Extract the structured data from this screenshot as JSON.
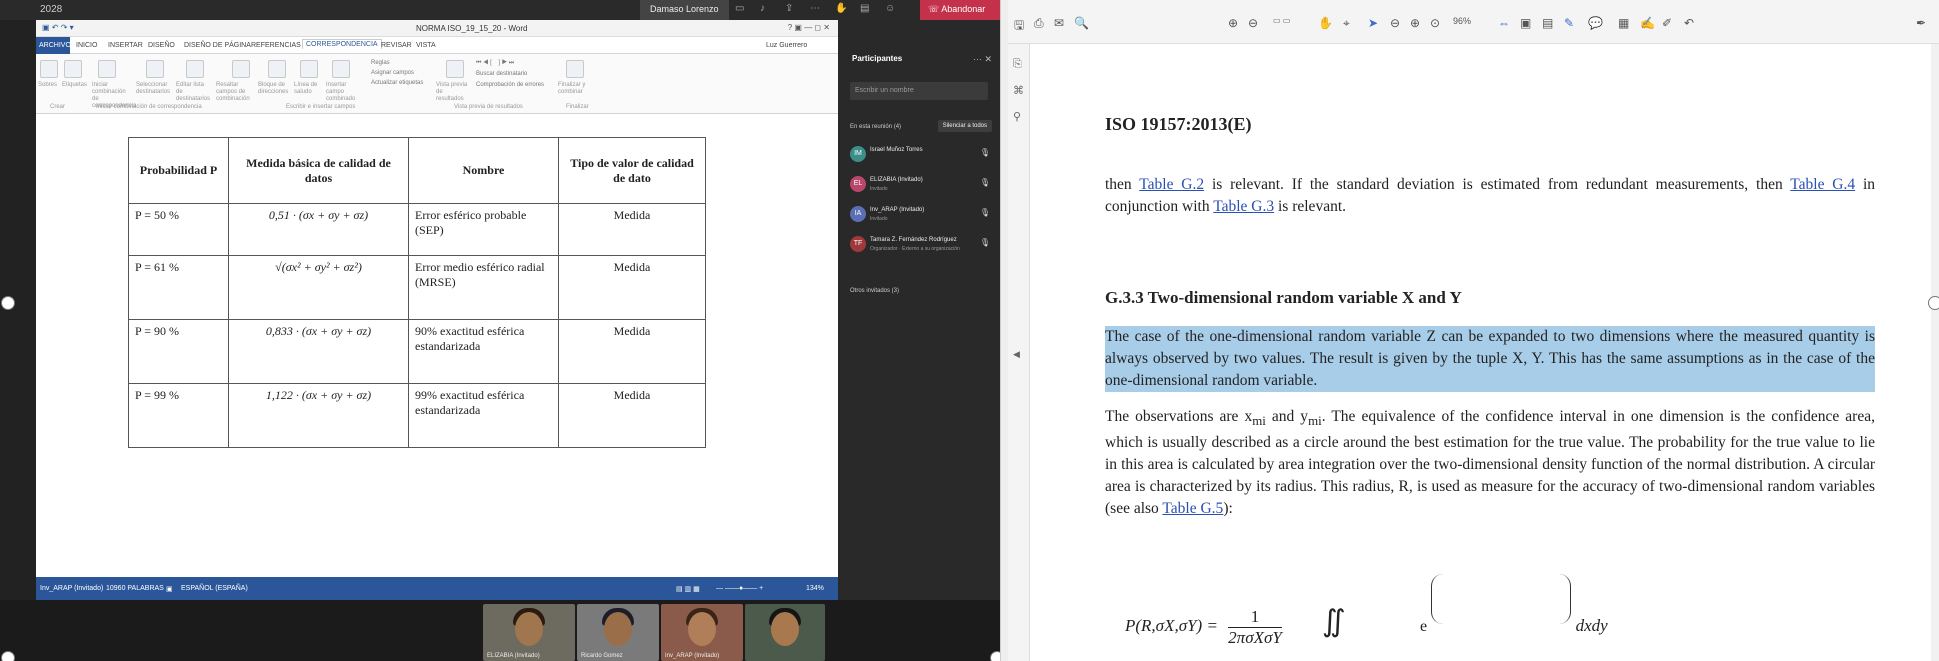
{
  "meeting": {
    "window_label": "2028",
    "user_name": "Damaso Lorenzo",
    "leave_label": "Abandonar"
  },
  "word": {
    "doc_title": "NORMA ISO_19_15_20 - Word",
    "account": "Luz Guerrero",
    "tabs": [
      "ARCHIVO",
      "INICIO",
      "INSERTAR",
      "DISEÑO",
      "DISEÑO DE PÁGINA",
      "REFERENCIAS",
      "CORRESPONDENCIA",
      "REVISAR",
      "VISTA"
    ],
    "active_tab": "CORRESPONDENCIA",
    "ribbon_buttons": [
      "Sobres",
      "Etiquetas",
      "Iniciar combinación de correspondencia",
      "Seleccionar destinatarios",
      "Editar lista de destinatarios",
      "Resaltar campos de combinación",
      "Bloque de direcciones",
      "Línea de saludo",
      "Insertar campo combinado",
      "Vista previa de resultados",
      "Finalizar y combinar"
    ],
    "ribbon_small": [
      "Reglas",
      "Asignar campos",
      "Actualizar etiquetas",
      "Buscar destinatario",
      "Comprobación de errores"
    ],
    "ribbon_groups": [
      "Crear",
      "Iniciar combinación de correspondencia",
      "Escribir e insertar campos",
      "Vista previa de resultados",
      "Finalizar"
    ],
    "table": {
      "headers": [
        "Probabilidad P",
        "Medida básica de calidad de datos",
        "Nombre",
        "Tipo de valor de calidad de dato"
      ],
      "rows": [
        {
          "p": "P = 50 %",
          "formula": "0,51 · (σx + σy + σz)",
          "name": "Error esférico probable (SEP)",
          "type": "Medida"
        },
        {
          "p": "P = 61 %",
          "formula": "√(σx² + σy² + σz²)",
          "name": "Error medio esférico radial (MRSE)",
          "type": "Medida"
        },
        {
          "p": "P = 90 %",
          "formula": "0,833 · (σx + σy + σz)",
          "name": "90% exactitud esférica estandarizada",
          "type": "Medida"
        },
        {
          "p": "P = 99 %",
          "formula": "1,122 · (σx + σy + σz)",
          "name": "99% exactitud esférica estandarizada",
          "type": "Medida"
        }
      ]
    },
    "status": {
      "left": "Inv_ARAP (Invitado)",
      "words": "10960 PALABRAS",
      "lang": "ESPAÑOL (ESPAÑA)",
      "zoom": "134%"
    }
  },
  "participants": {
    "title": "Participantes",
    "search_placeholder": "Escribir un nombre",
    "section": "En esta reunión (4)",
    "mute_all": "Silenciar a todos",
    "list": [
      {
        "name": "Israel Muñoz Torres",
        "sub": "",
        "initials": "IM",
        "color": "#3a8f8a"
      },
      {
        "name": "ELIZABIA (Invitado)",
        "sub": "Invitado",
        "initials": "EL",
        "color": "#b9476c"
      },
      {
        "name": "Inv_ARAP (Invitado)",
        "sub": "Invitado",
        "initials": "IA",
        "color": "#5b6fb5"
      },
      {
        "name": "Tamara Z. Fernández Rodríguez",
        "sub": "Organizador · Externo a su organización",
        "initials": "TF",
        "color": "#a03a3a"
      }
    ],
    "others": "Otros invitados (3)"
  },
  "videos": [
    {
      "label": "ELIZABIA (Invitado)"
    },
    {
      "label": "Ricardo Gomez"
    },
    {
      "label": "Inv_ARAP (Invitado)"
    },
    {
      "label": ""
    }
  ],
  "pdf": {
    "toolbar_zoom": "96%",
    "header": "ISO 19157:2013(E)",
    "p1_a": "then ",
    "p1_link1": "Table G.2",
    "p1_b": " is relevant. If the standard deviation is estimated from redundant measurements, then ",
    "p1_link2": "Table G.4",
    "p1_c": " in conjunction with ",
    "p1_link3": "Table G.3",
    "p1_d": " is relevant.",
    "section": "G.3.3   Two-dimensional random variable X and Y",
    "p2": "The case of the one-dimensional random variable Z can be expanded to two dimensions where the measured quantity is always observed by two values. The result is given by the tuple X, Y. This has the same assumptions as in the case of the one-dimensional random variable.",
    "p3_a": "The observations are x",
    "p3_b": " and y",
    "p3_c": ". The equivalence of the confidence interval in one dimension is the confidence area, which is usually described as a circle around the best estimation for the true value. The probability for the true value to lie in this area is calculated by area integration over the two-dimensional density function of the normal distribution. A circular area is characterized by its radius. This radius, R, is used as measure for the accuracy of two-dimensional random variables (see also ",
    "p3_link": "Table G.5",
    "p3_d": "):",
    "sub_mi": "mi",
    "formula_lhs": "P(R,σX,σY) =",
    "formula_frac_num": "1",
    "formula_frac_den": "2πσXσY",
    "formula_tail": "dxdy"
  }
}
